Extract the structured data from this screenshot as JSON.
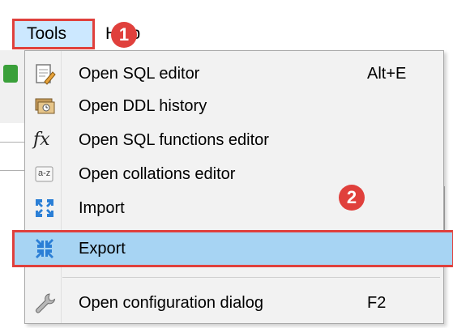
{
  "menubar": {
    "tools_label": "Tools",
    "help_label": "Help"
  },
  "callouts": {
    "step1": "1",
    "step2": "2"
  },
  "menu": {
    "items": [
      {
        "label": "Open SQL editor",
        "shortcut": "Alt+E",
        "icon": "sql-editor-icon"
      },
      {
        "label": "Open DDL history",
        "shortcut": "",
        "icon": "ddl-history-icon"
      },
      {
        "label": "Open SQL functions editor",
        "shortcut": "",
        "icon": "fx-icon"
      },
      {
        "label": "Open collations editor",
        "shortcut": "",
        "icon": "collations-icon"
      },
      {
        "label": "Import",
        "shortcut": "",
        "icon": "import-icon"
      },
      {
        "label": "Export",
        "shortcut": "",
        "icon": "export-icon"
      },
      {
        "label": "Open configuration dialog",
        "shortcut": "F2",
        "icon": "wrench-icon"
      }
    ],
    "fx_glyph": "fx",
    "az_glyph": "a-z"
  },
  "colors": {
    "highlight": "#a7d4f3",
    "callout_red": "#e0403c",
    "menu_bg": "#f2f2f2"
  }
}
